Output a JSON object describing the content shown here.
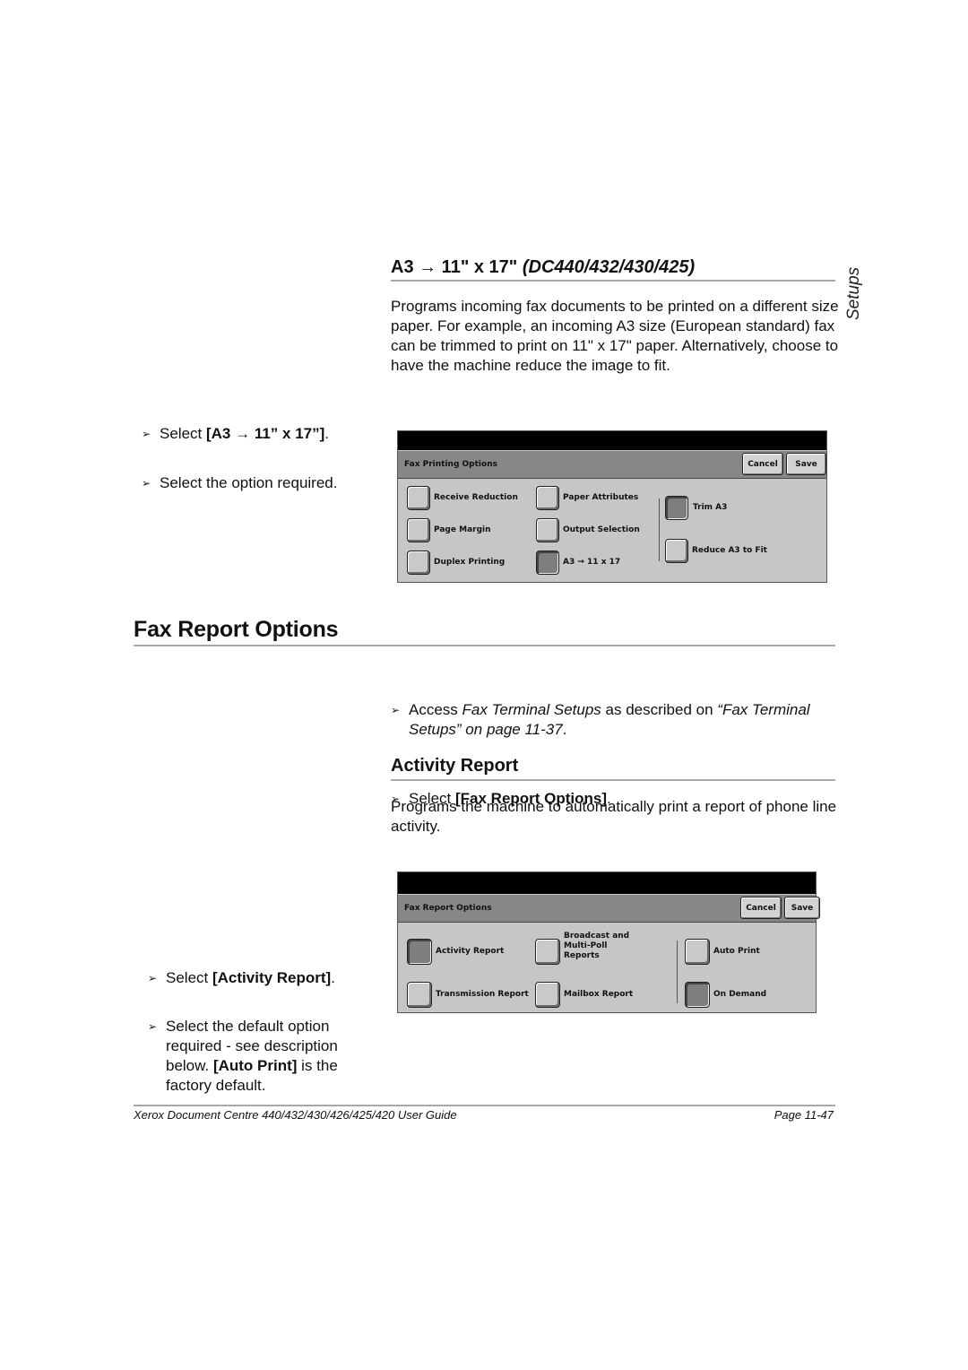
{
  "side_tab": "Setups",
  "section_a3": {
    "heading_main": "A3 → 11\" x 17\"",
    "heading_models": "(DC440/432/430/425)",
    "description": "Programs incoming fax documents to be printed on a different size paper. For example, an incoming A3  size (European standard) fax can be trimmed to print on 11\" x 17\" paper. Alternatively, choose to have the machine reduce the image to fit.",
    "steps": [
      {
        "prefix": "Select ",
        "bold": "[A3 → 11” x 17”]",
        "suffix": "."
      },
      {
        "text": "Select the option required."
      }
    ],
    "screen": {
      "title": "Fax Printing Options",
      "cancel_label": "Cancel",
      "save_label": "Save",
      "options": [
        {
          "label": "Receive Reduction",
          "selected": false
        },
        {
          "label": "Page Margin",
          "selected": false
        },
        {
          "label": "Duplex Printing",
          "selected": false
        },
        {
          "label": "Paper Attributes",
          "selected": false
        },
        {
          "label": "Output Selection",
          "selected": false
        },
        {
          "label": "A3 → 11 x 17",
          "selected": true
        }
      ],
      "choices": [
        {
          "label": "Trim A3",
          "selected": true
        },
        {
          "label": "Reduce A3 to Fit",
          "selected": false
        }
      ]
    }
  },
  "section_fax_report": {
    "heading": "Fax Report Options",
    "steps": [
      {
        "prefix": "Access ",
        "italic": "Fax Terminal Setups",
        "middle": " as described on ",
        "link": "“Fax Terminal Setups” on page 11-37",
        "suffix": "."
      },
      {
        "prefix": "Select ",
        "bold": "[Fax Report Options]",
        "suffix": "."
      }
    ]
  },
  "section_activity": {
    "heading": "Activity Report",
    "description": "Programs the machine to automatically print a report of phone line activity.",
    "steps": [
      {
        "prefix": "Select ",
        "bold": "[Activity Report]",
        "suffix": "."
      },
      {
        "prefix": "Select the default option required - see description below. ",
        "bold": "[Auto Print]",
        "suffix": " is the factory default."
      }
    ],
    "screen": {
      "title": "Fax Report Options",
      "cancel_label": "Cancel",
      "save_label": "Save",
      "options": [
        {
          "label": "Activity Report",
          "selected": true
        },
        {
          "label": "Transmission Report",
          "selected": false
        },
        {
          "label": "Broadcast and Multi-Poll Reports",
          "selected": false
        },
        {
          "label": "Mailbox Report",
          "selected": false
        }
      ],
      "choices": [
        {
          "label": "Auto Print",
          "selected": false
        },
        {
          "label": "On Demand",
          "selected": true
        }
      ]
    }
  },
  "footer": {
    "guide_title": "Xerox Document Centre 440/432/430/426/425/420 User Guide",
    "page": "Page 11-47"
  }
}
